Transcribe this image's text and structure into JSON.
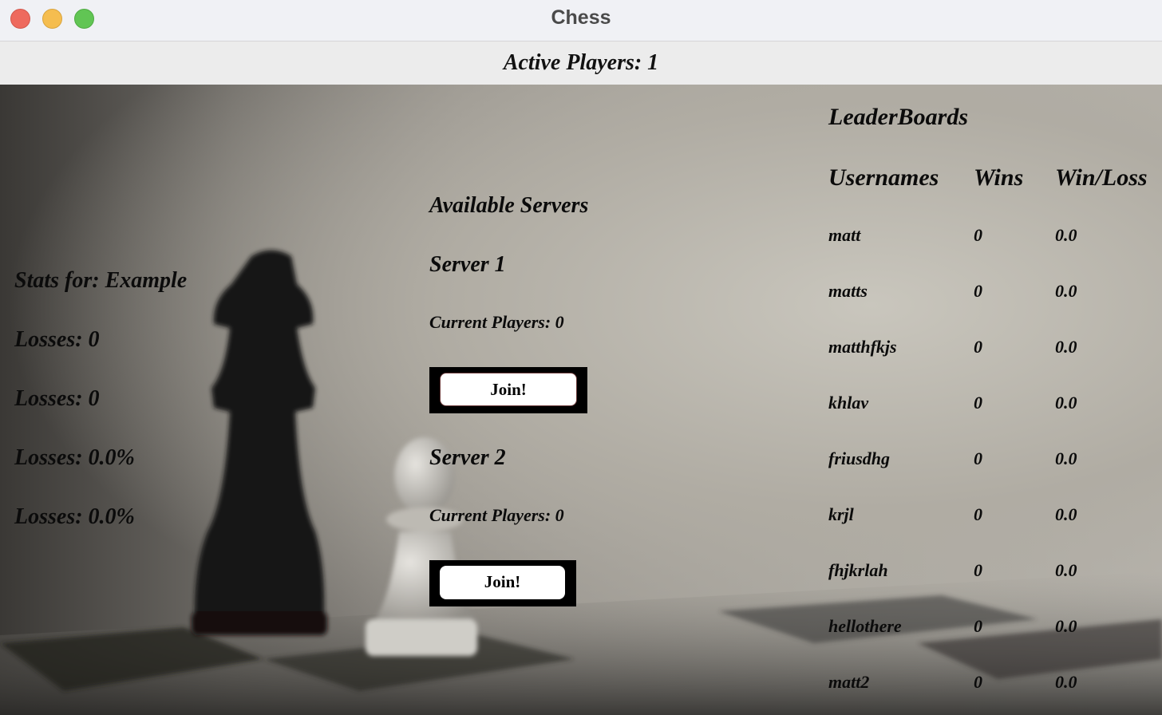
{
  "window": {
    "title": "Chess"
  },
  "header": {
    "active_players": "Active Players: 1"
  },
  "stats": {
    "title": "Stats for: Example",
    "lines": [
      "Losses: 0",
      "Losses: 0",
      "Losses: 0.0%",
      "Losses: 0.0%"
    ]
  },
  "servers": {
    "heading": "Available Servers",
    "list": [
      {
        "name": "Server 1",
        "players": "Current Players: 0",
        "join_label": "Join!"
      },
      {
        "name": "Server 2",
        "players": "Current Players: 0",
        "join_label": "Join!"
      }
    ]
  },
  "leaderboard": {
    "title": "LeaderBoards",
    "columns": [
      "Usernames",
      "Wins",
      "Win/Loss"
    ],
    "rows": [
      {
        "username": "matt",
        "wins": "0",
        "ratio": "0.0"
      },
      {
        "username": "matts",
        "wins": "0",
        "ratio": "0.0"
      },
      {
        "username": "matthfkjs",
        "wins": "0",
        "ratio": "0.0"
      },
      {
        "username": "khlav",
        "wins": "0",
        "ratio": "0.0"
      },
      {
        "username": "friusdhg",
        "wins": "0",
        "ratio": "0.0"
      },
      {
        "username": "krjl",
        "wins": "0",
        "ratio": "0.0"
      },
      {
        "username": "fhjkrlah",
        "wins": "0",
        "ratio": "0.0"
      },
      {
        "username": "hellothere",
        "wins": "0",
        "ratio": "0.0"
      },
      {
        "username": "matt2",
        "wins": "0",
        "ratio": "0.0"
      }
    ]
  },
  "colors": {
    "close": "#ee6a5e",
    "minimize": "#f5bd4f",
    "maximize": "#61c554"
  },
  "background_image": "chess-pieces-photo"
}
